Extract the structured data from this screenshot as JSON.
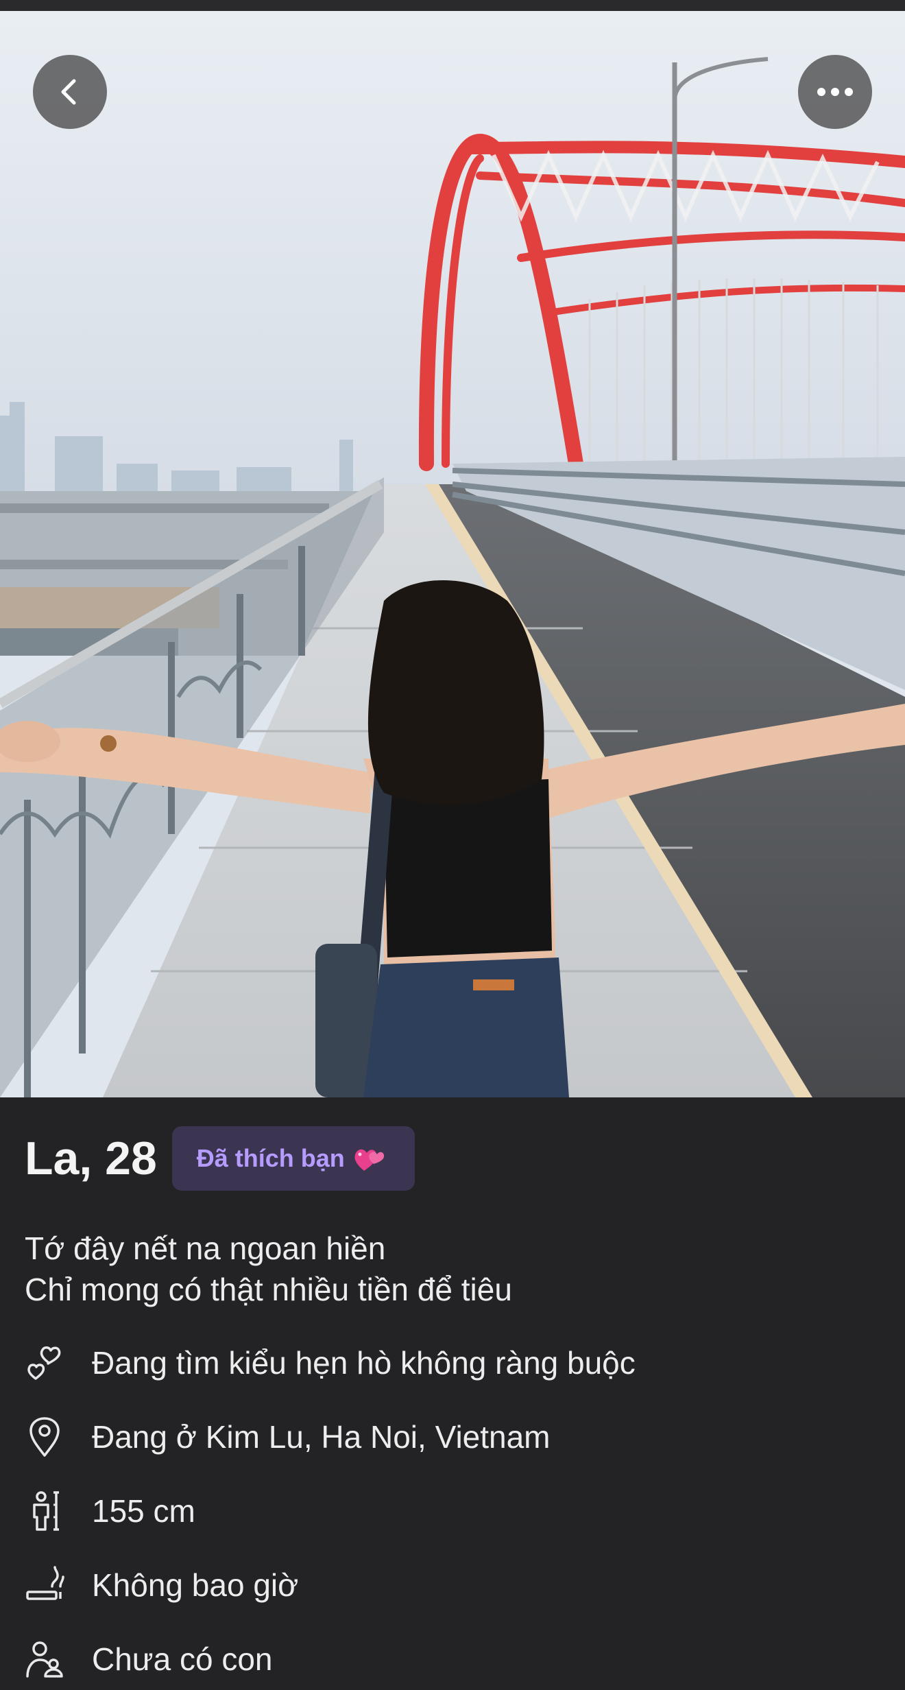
{
  "navigation": {
    "back_icon": "chevron-left-icon",
    "more_icon": "more-horizontal-icon"
  },
  "profile": {
    "name_age": "La, 28",
    "liked_badge": "Đã thích bạn",
    "liked_badge_emoji": "heart-emoji",
    "bio_lines": [
      "Tớ đây nết na ngoan hiền",
      "Chỉ mong có thật nhiều tiền để tiêu"
    ],
    "attributes": [
      {
        "icon": "hearts-icon",
        "text": "Đang tìm kiểu hẹn hò không ràng buộc"
      },
      {
        "icon": "location-pin-icon",
        "text": "Đang ở Kim Lu, Ha Noi, Vietnam"
      },
      {
        "icon": "height-icon",
        "text": "155 cm"
      },
      {
        "icon": "smoking-icon",
        "text": "Không bao giờ"
      },
      {
        "icon": "children-icon",
        "text": "Chưa có con"
      }
    ]
  },
  "colors": {
    "background": "#232326",
    "badge_bg": "#3b3552",
    "badge_text": "#b79cff",
    "bridge_arch": "#e2403f"
  }
}
